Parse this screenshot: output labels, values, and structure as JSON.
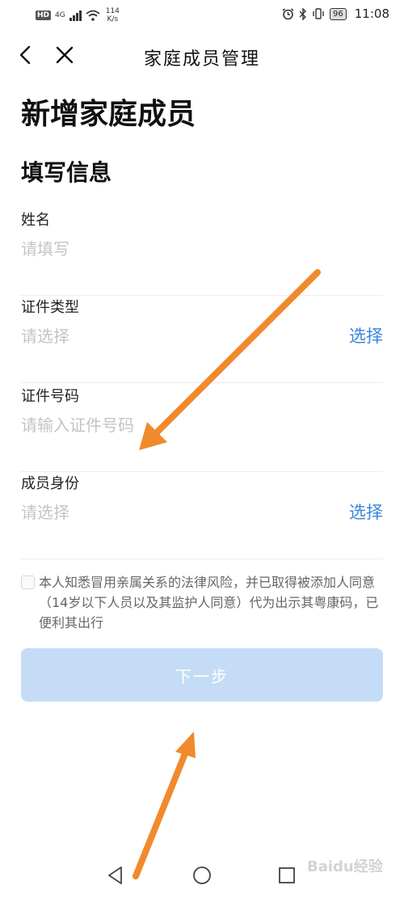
{
  "status_bar": {
    "hd": "HD",
    "network": "4G",
    "speed_value": "114",
    "speed_unit": "K/s",
    "battery": "96",
    "time": "11:08"
  },
  "nav": {
    "title": "家庭成员管理"
  },
  "page": {
    "title": "新增家庭成员",
    "section_title": "填写信息"
  },
  "form": {
    "fields": [
      {
        "label": "姓名",
        "placeholder": "请填写",
        "action": ""
      },
      {
        "label": "证件类型",
        "placeholder": "请选择",
        "action": "选择"
      },
      {
        "label": "证件号码",
        "placeholder": "请输入证件号码",
        "action": ""
      },
      {
        "label": "成员身份",
        "placeholder": "请选择",
        "action": "选择"
      }
    ],
    "agreement": "本人知悉冒用亲属关系的法律风险，并已取得被添加人同意（14岁以下人员以及其监护人同意）代为出示其粤康码，已便利其出行",
    "agreement_checked": false,
    "next_button": "下一步"
  },
  "watermark": "Baidu经验",
  "colors": {
    "accent": "#3b86d6",
    "button_disabled": "#c5dcf7",
    "arrow": "#f08a2c"
  }
}
